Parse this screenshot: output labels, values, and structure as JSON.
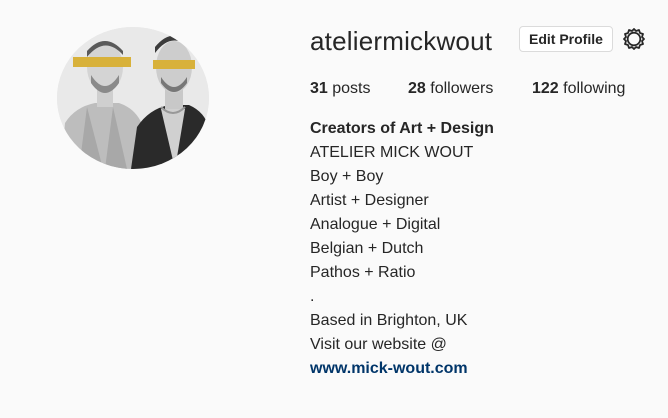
{
  "profile": {
    "username": "ateliermickwout",
    "edit_button_label": "Edit Profile",
    "settings_icon": "gear-icon",
    "avatar_icon": "profile-photo"
  },
  "stats": {
    "posts_count": "31",
    "posts_label": "posts",
    "followers_count": "28",
    "followers_label": "followers",
    "following_count": "122",
    "following_label": "following"
  },
  "bio": {
    "name": "Creators of Art + Design",
    "lines": [
      "ATELIER MICK WOUT",
      "Boy + Boy",
      "Artist + Designer",
      "Analogue + Digital",
      "Belgian + Dutch",
      "Pathos + Ratio",
      ".",
      "Based in Brighton, UK",
      "Visit our website @"
    ],
    "website": "www.mick-wout.com"
  },
  "colors": {
    "background": "#fafafa",
    "text": "#262626",
    "link": "#003569",
    "button_border": "#dbdbdb",
    "eye_bar": "#d8b13a"
  }
}
